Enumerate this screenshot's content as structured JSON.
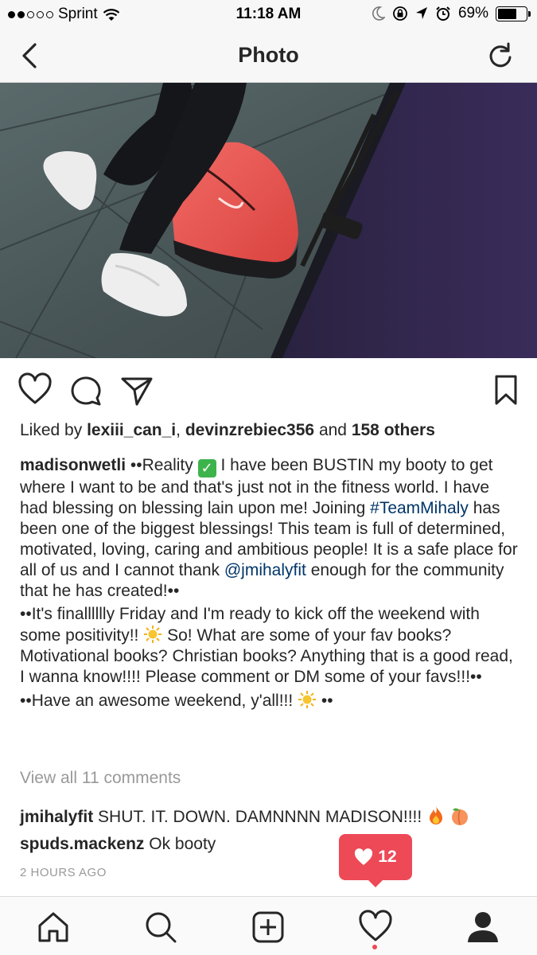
{
  "status_bar": {
    "carrier": "Sprint",
    "time": "11:18 AM",
    "battery": "69%",
    "battery_level": 0.69,
    "signal_bars_filled": 2,
    "signal_bars_total": 5
  },
  "nav": {
    "title": "Photo",
    "back_icon": "chevron-left-icon",
    "refresh_icon": "refresh-icon"
  },
  "post": {
    "likes": {
      "prefix": "Liked by",
      "user1": "lexiii_can_i",
      "separator": ",",
      "user2": "devinzrebiec356",
      "and": "and",
      "others": "158 others"
    },
    "caption": {
      "username": "madisonwetli",
      "p1_a": "••Reality",
      "p1_b": "I have been BUSTIN my booty to get where I want to be and that's just not in the fitness world. I have had blessing on blessing lain upon me! Joining",
      "hashtag": "#TeamMihaly",
      "p1_c": "has been one of the biggest blessings! This team is full of determined, motivated, loving, caring and ambitious people! It is a safe place for all of us and I cannot thank",
      "mention": "@jmihalyfit",
      "p1_d": "enough for the community that he has created!••",
      "p2_a": "••It's finalllllly Friday and I'm ready to kick off the weekend with some positivity!!",
      "p2_b": "So! What are some of your fav books? Motivational books? Christian books? Anything that is a good read, I wanna know!!!! Please comment or DM some of your favs!!!••",
      "p3_a": "••Have an awesome weekend, y'all!!!",
      "p3_b": "••"
    },
    "view_all_comments": "View all 11 comments",
    "comments": [
      {
        "user": "jmihalyfit",
        "text": "SHUT. IT. DOWN. DAMNNNN MADISON!!!!"
      },
      {
        "user": "spuds.mackenz",
        "text": "Ok booty"
      }
    ],
    "time_ago": "2 HOURS AGO"
  },
  "notification": {
    "count": "12"
  },
  "colors": {
    "accent_red": "#ed4956",
    "link_blue": "#003569",
    "muted_gray": "#999999",
    "text": "#262626"
  }
}
